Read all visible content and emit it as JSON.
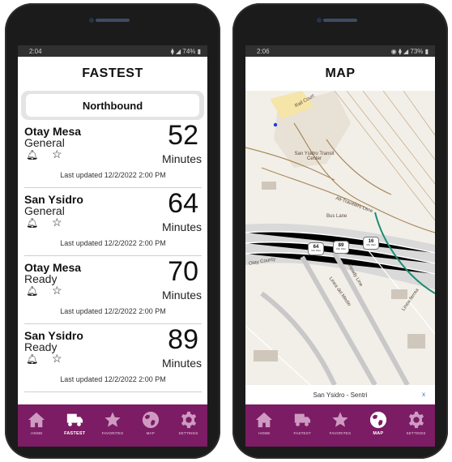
{
  "left_phone": {
    "status_time": "2:04",
    "status_right": "⧫ ◢ 74% ▮",
    "title": "FASTEST",
    "direction": "Northbound",
    "cards": [
      {
        "port": "Otay Mesa",
        "lane": "General",
        "wait": "52",
        "unit": "Minutes",
        "updated": "Last updated 12/2/2022 2:00 PM"
      },
      {
        "port": "San Ysidro",
        "lane": "General",
        "wait": "64",
        "unit": "Minutes",
        "updated": "Last updated 12/2/2022 2:00 PM"
      },
      {
        "port": "Otay Mesa",
        "lane": "Ready",
        "wait": "70",
        "unit": "Minutes",
        "updated": "Last updated 12/2/2022 2:00 PM"
      },
      {
        "port": "San Ysidro",
        "lane": "Ready",
        "wait": "89",
        "unit": "Minutes",
        "updated": "Last updated 12/2/2022 2:00 PM"
      }
    ],
    "nav": [
      "HOME",
      "FASTEST",
      "FAVORITES",
      "MAP",
      "SETTINGS"
    ],
    "active_nav": "FASTEST"
  },
  "right_phone": {
    "status_time": "2:06",
    "status_right": "◉ ⧫ ◢ 73% ▮",
    "title": "MAP",
    "markers": [
      {
        "value": "64",
        "sub": "Min Wait"
      },
      {
        "value": "89",
        "sub": "Min Wait"
      },
      {
        "value": "16",
        "sub": "Min Wait"
      }
    ],
    "map_labels": {
      "rail_court": "Rail Court",
      "transit": "San Ysidro Transit Center",
      "all_travelers": "All-Travelers Lane",
      "bus_lane": "Bus Lane",
      "ready_line": "Ready Line",
      "linea_medio": "Linea del Medio",
      "otay_county": "Otay County",
      "linea_ferrea": "Linea ferrea"
    },
    "footer": "San Ysidro - Sentri",
    "close": "x",
    "nav": [
      "HOME",
      "FASTEST",
      "FAVORITES",
      "MAP",
      "SETTINGS"
    ],
    "active_nav": "MAP"
  },
  "colors": {
    "nav_bg": "#7b1c64",
    "frame": "#1b1b1b"
  },
  "icons": [
    "home-icon",
    "truck-icon",
    "star-icon",
    "globe-icon",
    "gear-icon",
    "bell-icon",
    "star-outline-icon"
  ]
}
